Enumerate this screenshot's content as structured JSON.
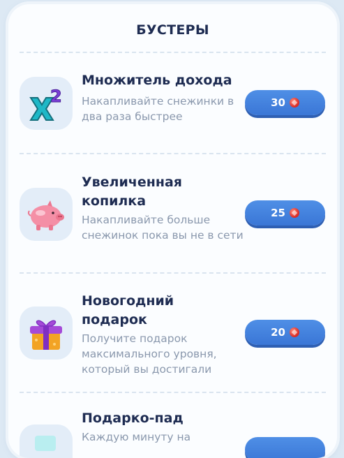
{
  "header": {
    "title": "БУСТЕРЫ"
  },
  "boosters": [
    {
      "title": "Множитель дохода",
      "description": "Накапливайте снежинки в два раза быстрее",
      "price": "30",
      "icon": "x2-multiplier-icon"
    },
    {
      "title": "Увеличенная копилка",
      "description": "Накапливайте больше снежинок пока вы не в сети",
      "price": "25",
      "icon": "piggy-bank-icon"
    },
    {
      "title": "Новогодний подарок",
      "description": "Получите подарок максимального уровня, который вы достигали",
      "price": "20",
      "icon": "gift-box-icon"
    },
    {
      "title": "Подарко-пад",
      "description": "Каждую минуту на",
      "price": "",
      "icon": "gift-fall-icon"
    }
  ],
  "colors": {
    "accent_button": "#3a76d6",
    "gem": "#e0322a",
    "title_text": "#1e2c52",
    "muted_text": "#8a98ad"
  }
}
